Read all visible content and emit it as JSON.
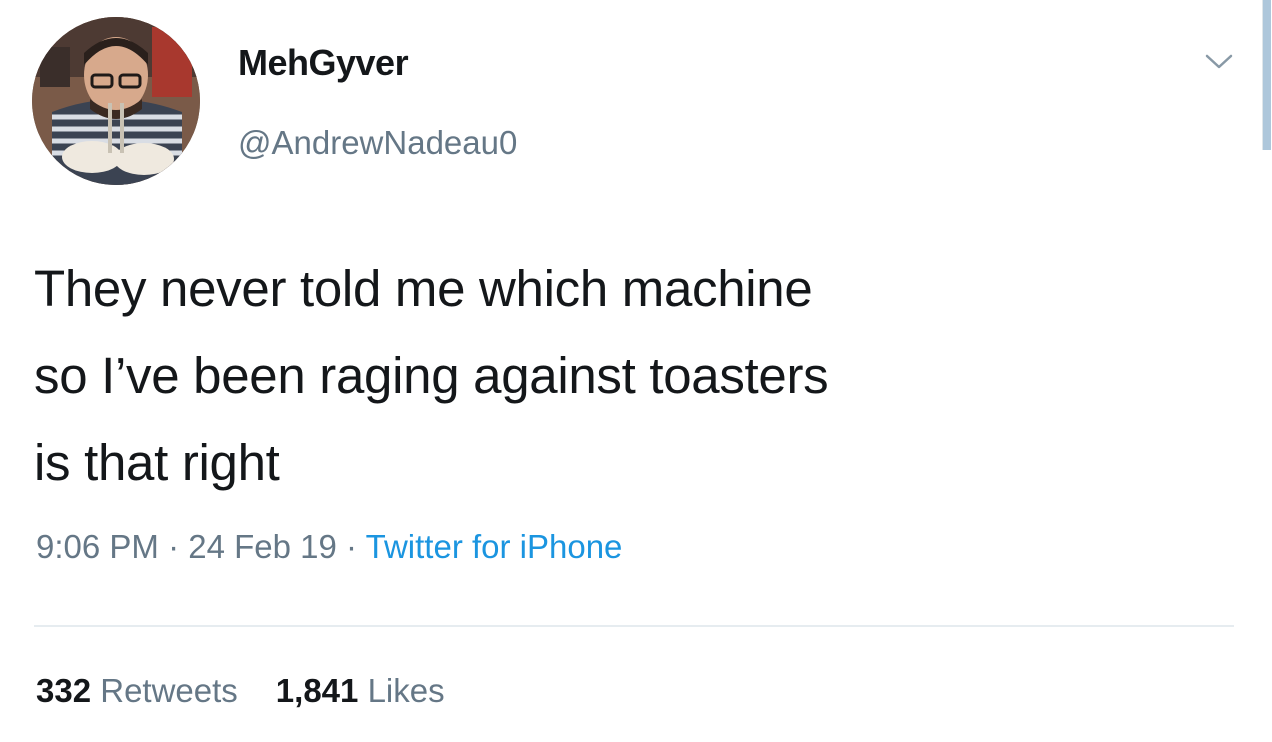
{
  "user": {
    "display_name": "MehGyver",
    "handle": "@AndrewNadeau0"
  },
  "tweet": {
    "lines": [
      "They never told me which machine",
      "so I’ve been raging against toasters",
      "is that right"
    ],
    "time": "9:06 PM",
    "separator": "·",
    "date": "24 Feb 19",
    "source": "Twitter for iPhone"
  },
  "stats": {
    "retweets_count": "332",
    "retweets_label": "Retweets",
    "likes_count": "1,841",
    "likes_label": "Likes"
  },
  "icons": {
    "menu": "chevron-down-icon",
    "avatar": "avatar-photo"
  },
  "colors": {
    "text": "#14171a",
    "secondary": "#657786",
    "link": "#1b95e0",
    "divider": "#e6ecf0"
  }
}
